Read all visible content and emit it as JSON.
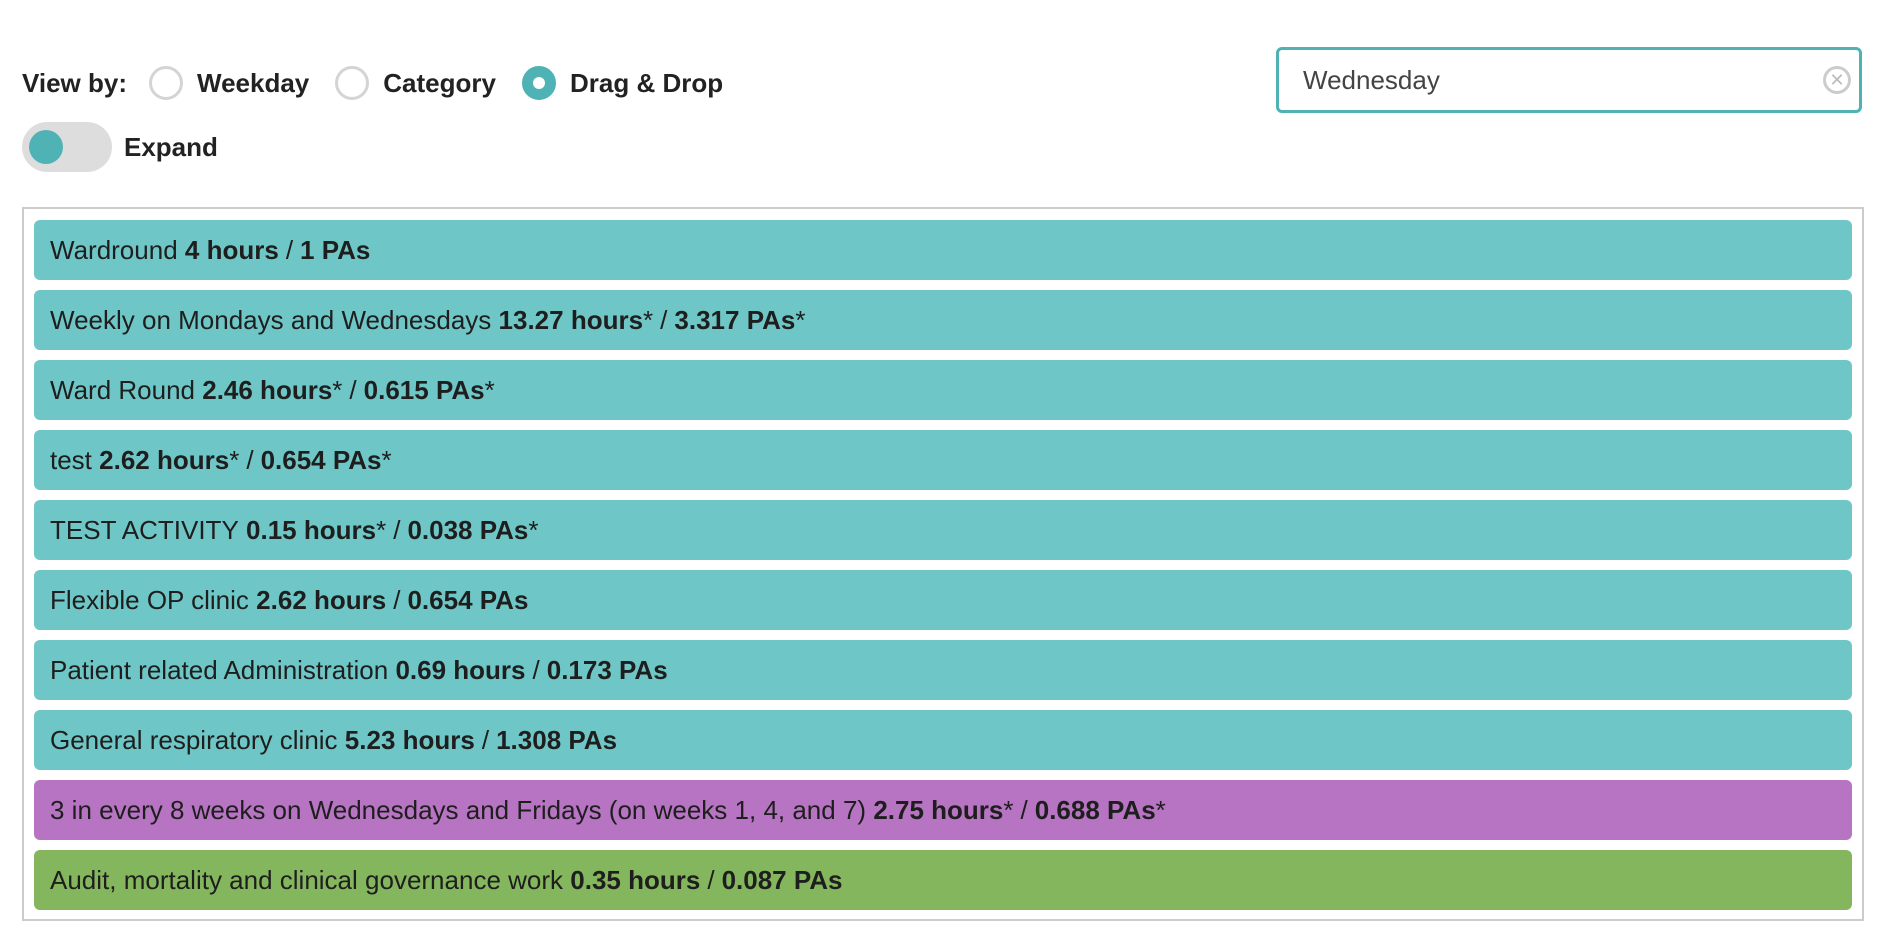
{
  "view_by": {
    "label": "View by:",
    "options": [
      {
        "label": "Weekday",
        "checked": false
      },
      {
        "label": "Category",
        "checked": false
      },
      {
        "label": "Drag & Drop",
        "checked": true
      }
    ]
  },
  "search": {
    "value": "Wednesday",
    "clear_glyph": "✕"
  },
  "expand": {
    "label": "Expand",
    "on": false
  },
  "colors": {
    "accent": "#4fb2b4",
    "teal_item": "#6fc6c6",
    "purple_item": "#b774c2",
    "green_item": "#84b75d"
  },
  "activities": [
    {
      "name": "Wardround",
      "hours": "4 hours",
      "hours_mark": "",
      "pas": "1 PAs",
      "pas_mark": "",
      "color": "teal"
    },
    {
      "name": "Weekly on Mondays and Wednesdays",
      "hours": "13.27 hours",
      "hours_mark": " *",
      "pas": "3.317 PAs",
      "pas_mark": " *",
      "color": "teal"
    },
    {
      "name": "Ward Round",
      "hours": "2.46 hours",
      "hours_mark": " *",
      "pas": "0.615 PAs",
      "pas_mark": " *",
      "color": "teal"
    },
    {
      "name": "test",
      "hours": "2.62 hours",
      "hours_mark": " *",
      "pas": "0.654 PAs",
      "pas_mark": " *",
      "color": "teal"
    },
    {
      "name": "TEST ACTIVITY",
      "hours": "0.15 hours",
      "hours_mark": " *",
      "pas": "0.038 PAs",
      "pas_mark": " *",
      "color": "teal"
    },
    {
      "name": "Flexible OP clinic",
      "hours": "2.62 hours",
      "hours_mark": "",
      "pas": "0.654 PAs",
      "pas_mark": "",
      "color": "teal"
    },
    {
      "name": "Patient related Administration",
      "hours": "0.69 hours",
      "hours_mark": "",
      "pas": "0.173 PAs",
      "pas_mark": "",
      "color": "teal"
    },
    {
      "name": "General respiratory clinic",
      "hours": "5.23 hours",
      "hours_mark": "",
      "pas": "1.308 PAs",
      "pas_mark": "",
      "color": "teal"
    },
    {
      "name": "3 in every 8 weeks on Wednesdays and Fridays (on weeks 1, 4, and 7)",
      "hours": "2.75 hours",
      "hours_mark": " *",
      "pas": "0.688 PAs",
      "pas_mark": " *",
      "color": "purple"
    },
    {
      "name": "Audit, mortality and clinical governance work",
      "hours": "0.35 hours",
      "hours_mark": "",
      "pas": "0.087 PAs",
      "pas_mark": "",
      "color": "green"
    }
  ],
  "separator": "/"
}
